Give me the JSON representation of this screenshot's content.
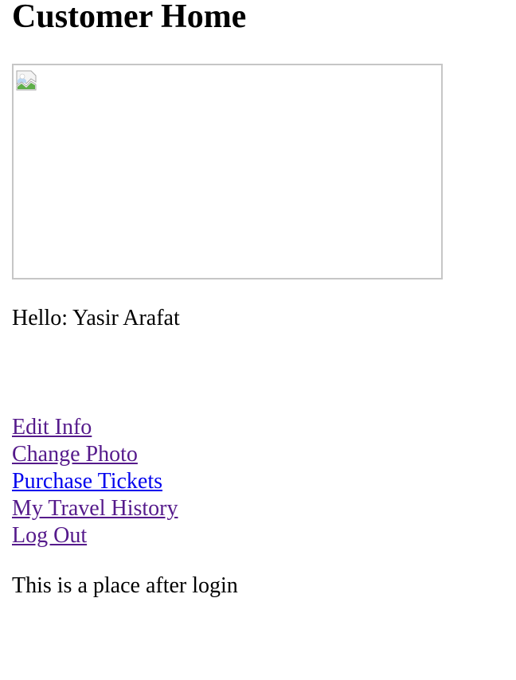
{
  "page": {
    "title": "Customer Home",
    "greeting_label": "Hello: Yasir Arafat",
    "note": "This is a place after login"
  },
  "photo": {
    "state": "broken-image",
    "icon": "broken-image-icon"
  },
  "links": [
    {
      "label": "Edit Info",
      "visited": true
    },
    {
      "label": "Change Photo",
      "visited": true
    },
    {
      "label": "Purchase Tickets",
      "visited": false
    },
    {
      "label": "My Travel History",
      "visited": true
    },
    {
      "label": "Log Out",
      "visited": true
    }
  ],
  "colors": {
    "visited_link": "#551a8b",
    "unvisited_link": "#0000ee",
    "image_border": "#c6c6c6"
  }
}
